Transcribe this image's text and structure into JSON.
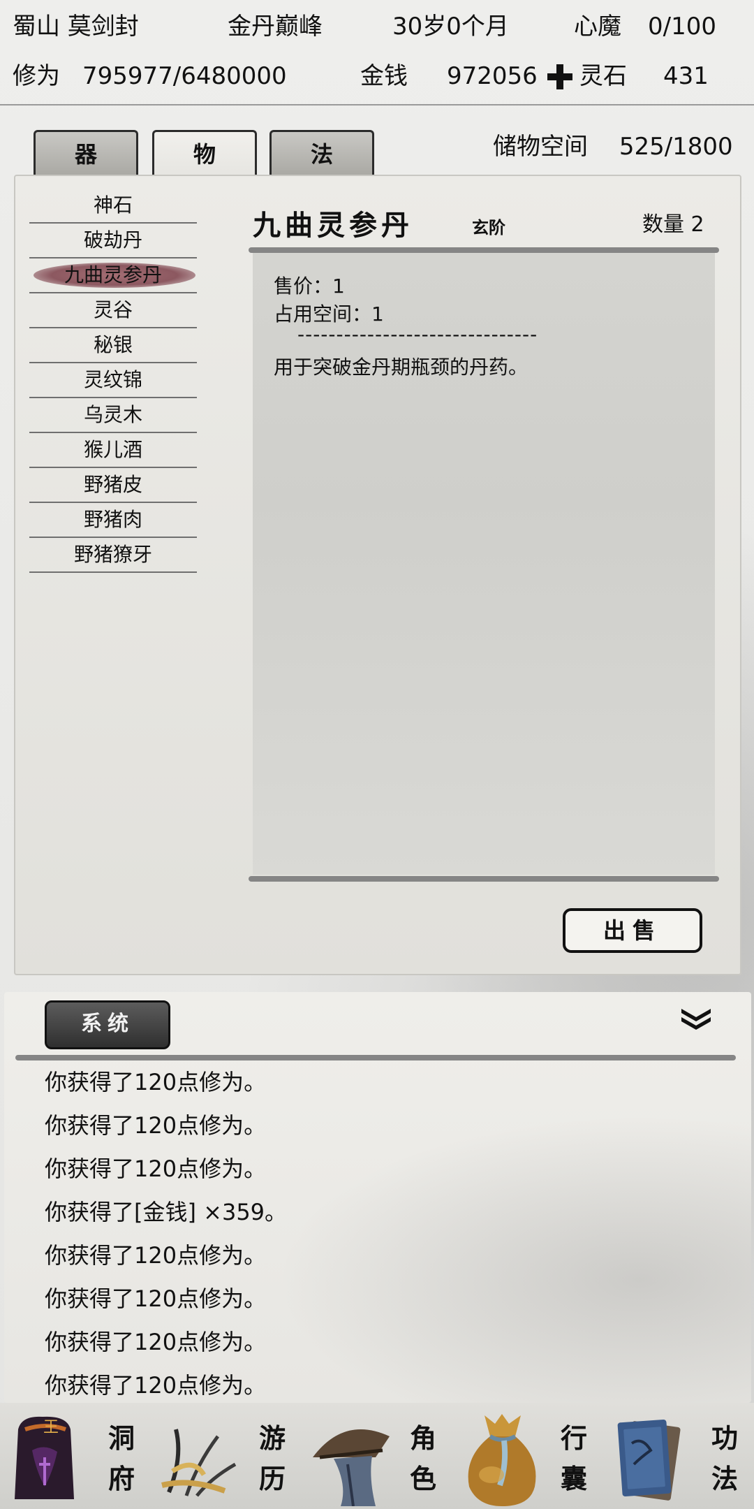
{
  "header": {
    "location": "蜀山 莫剑封",
    "realm": "金丹巅峰",
    "age": "30岁0个月",
    "heart_demon_label": "心魔",
    "heart_demon_value": "0/100",
    "cultivation_label": "修为",
    "cultivation_value": "795977/6480000",
    "money_label": "金钱",
    "money_value": "972056",
    "spirit_stone_label": "灵石",
    "spirit_stone_value": "431"
  },
  "tabs": [
    {
      "label": "器",
      "active": false
    },
    {
      "label": "物",
      "active": true
    },
    {
      "label": "法",
      "active": false
    }
  ],
  "storage": {
    "label": "储物空间",
    "value": "525/1800"
  },
  "items": [
    {
      "name": "神石"
    },
    {
      "name": "破劫丹"
    },
    {
      "name": "九曲灵参丹",
      "selected": true
    },
    {
      "name": "灵谷"
    },
    {
      "name": "秘银"
    },
    {
      "name": "灵纹锦"
    },
    {
      "name": "乌灵木"
    },
    {
      "name": "猴儿酒"
    },
    {
      "name": "野猪皮"
    },
    {
      "name": "野猪肉"
    },
    {
      "name": "野猪獠牙"
    }
  ],
  "detail": {
    "name": "九曲灵参丹",
    "grade": "玄阶",
    "quantity": "数量 2",
    "price": "售价：1",
    "space": "占用空间：1",
    "separator": "-------------------------------",
    "description": "用于突破金丹期瓶颈的丹药。"
  },
  "sell_button": "出售",
  "log": {
    "tab_label": "系统",
    "lines": [
      "你获得了120点修为。",
      "你获得了120点修为。",
      "你获得了120点修为。",
      "你获得了[金钱] ×359。",
      "你获得了120点修为。",
      "你获得了120点修为。",
      "你获得了120点修为。",
      "你获得了120点修为。"
    ]
  },
  "nav": [
    {
      "label": "洞府",
      "icon": "cave-dwelling-icon"
    },
    {
      "label": "游历",
      "icon": "travel-icon"
    },
    {
      "label": "角色",
      "icon": "character-icon"
    },
    {
      "label": "行囊",
      "icon": "bag-icon"
    },
    {
      "label": "功法",
      "icon": "scroll-books-icon"
    }
  ],
  "nav_seal_text": "王",
  "colors": {
    "selected_item": "#8c5860",
    "bar": "#858585",
    "system_tab": "#3a3a3a"
  }
}
